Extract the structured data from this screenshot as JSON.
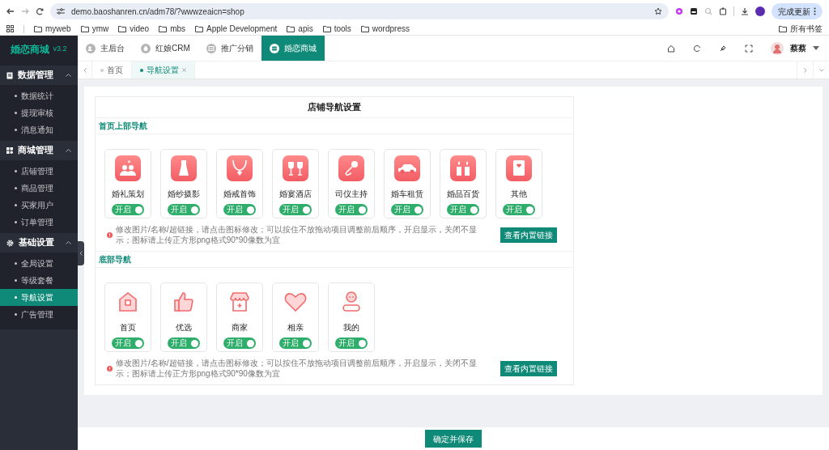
{
  "browser": {
    "url": "demo.baoshanren.cn/adm78/?wwwzeaicn=shop",
    "bookmarks": [
      "myweb",
      "ymw",
      "video",
      "mbs",
      "Apple Development",
      "apis",
      "tools",
      "wordpress"
    ],
    "all_bookmarks": "所有书签",
    "update_button": "完成更新"
  },
  "sidebar": {
    "logo": "婚恋商城",
    "version": "v3.2",
    "groups": [
      {
        "label": "数据管理",
        "expanded": true,
        "items": [
          {
            "label": "数据统计",
            "selected": false
          },
          {
            "label": "提现审核",
            "selected": false
          },
          {
            "label": "消息通知",
            "selected": false
          }
        ]
      },
      {
        "label": "商城管理",
        "expanded": true,
        "items": [
          {
            "label": "店铺管理",
            "selected": false
          },
          {
            "label": "商品管理",
            "selected": false
          },
          {
            "label": "买家用户",
            "selected": false
          },
          {
            "label": "订单管理",
            "selected": false
          }
        ]
      },
      {
        "label": "基础设置",
        "expanded": true,
        "items": [
          {
            "label": "全局设置",
            "selected": false
          },
          {
            "label": "等级套餐",
            "selected": false
          },
          {
            "label": "导航设置",
            "selected": true
          },
          {
            "label": "广告管理",
            "selected": false
          }
        ]
      }
    ]
  },
  "top_tabs": [
    {
      "label": "主后台",
      "selected": false
    },
    {
      "label": "红娘CRM",
      "selected": false
    },
    {
      "label": "推广分销",
      "selected": false
    },
    {
      "label": "婚恋商城",
      "selected": true
    }
  ],
  "user": {
    "name": "蔡蔡"
  },
  "page_tabs": [
    {
      "label": "首页",
      "selected": false,
      "closable": false
    },
    {
      "label": "导航设置",
      "selected": true,
      "closable": true
    }
  ],
  "panel": {
    "title": "店铺导航设置",
    "sections": [
      {
        "title": "首页上部导航",
        "items": [
          {
            "label": "婚礼策划",
            "on": true,
            "switch_text": "开启"
          },
          {
            "label": "婚纱摄影",
            "on": true,
            "switch_text": "开启"
          },
          {
            "label": "婚戒首饰",
            "on": true,
            "switch_text": "开启"
          },
          {
            "label": "婚宴酒店",
            "on": true,
            "switch_text": "开启"
          },
          {
            "label": "司仪主持",
            "on": true,
            "switch_text": "开启"
          },
          {
            "label": "婚车租赁",
            "on": true,
            "switch_text": "开启"
          },
          {
            "label": "婚品百货",
            "on": true,
            "switch_text": "开启"
          },
          {
            "label": "其他",
            "on": true,
            "switch_text": "开启"
          }
        ],
        "hint": "修改图片/名称/超链接，请点击图标修改；可以按住不放拖动项目调整前后顺序，开启显示，关闭不显示；图标请上传正方形png格式90*90像数为宜",
        "link_button": "查看内置链接"
      },
      {
        "title": "底部导航",
        "items": [
          {
            "label": "首页",
            "on": true,
            "switch_text": "开启"
          },
          {
            "label": "优选",
            "on": true,
            "switch_text": "开启"
          },
          {
            "label": "商家",
            "on": true,
            "switch_text": "开启"
          },
          {
            "label": "相亲",
            "on": true,
            "switch_text": "开启"
          },
          {
            "label": "我的",
            "on": true,
            "switch_text": "开启"
          }
        ],
        "hint": "修改图片/名称/超链接，请点击图标修改；可以按住不放拖动项目调整前后顺序，开启显示，关闭不显示；图标请上传正方形png格式90*90像数为宜",
        "link_button": "查看内置链接"
      }
    ]
  },
  "save_button": "确定并保存"
}
